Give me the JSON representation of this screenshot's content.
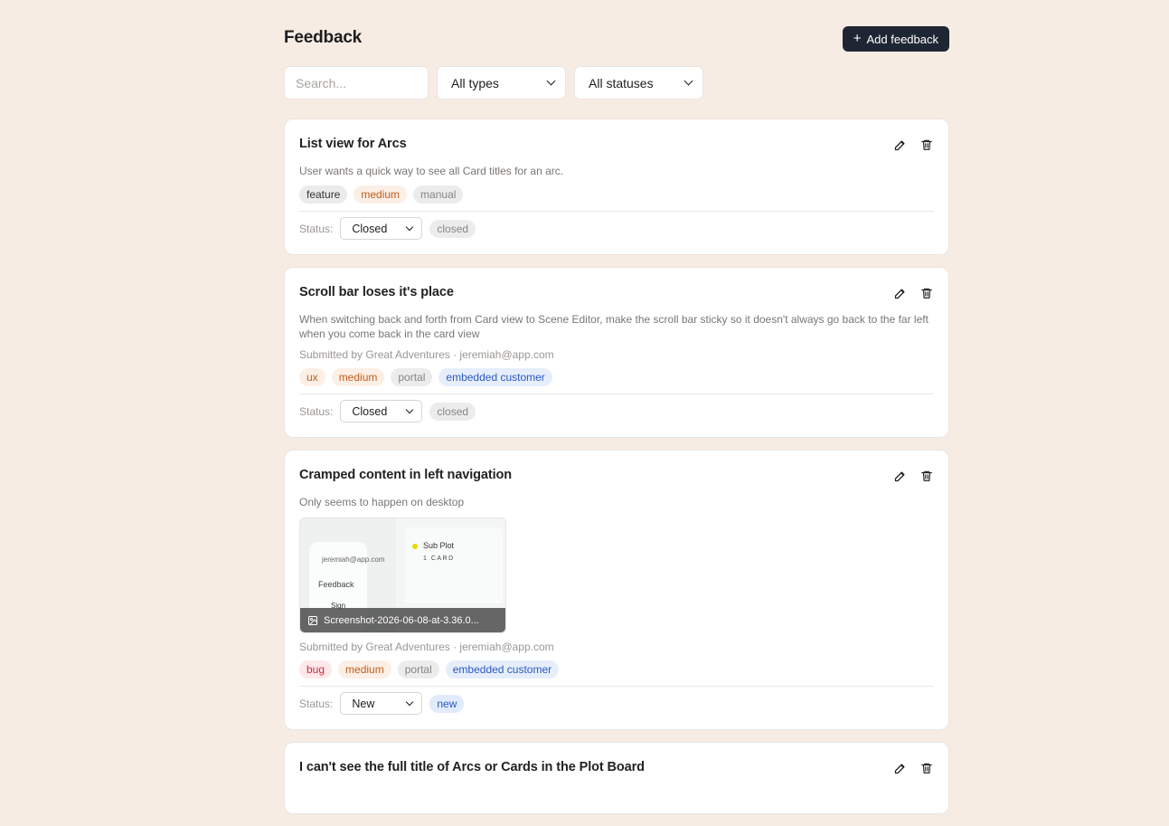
{
  "header": {
    "title": "Feedback",
    "add_button_label": "Add feedback"
  },
  "filters": {
    "search_placeholder": "Search...",
    "type_filter": "All types",
    "status_filter": "All statuses"
  },
  "status_label": "Status:",
  "cards": [
    {
      "title": "List view for Arcs",
      "description": "User wants a quick way to see all Card titles for an arc.",
      "tags": [
        "feature",
        "medium",
        "manual"
      ],
      "status": "Closed",
      "status_badge": "closed"
    },
    {
      "title": "Scroll bar loses it's place",
      "description": "When switching back and forth from Card view to Scene Editor, make the scroll bar sticky so it doesn't always go back to the far left when you come back in the card view",
      "submitted": "Submitted by Great Adventures · jeremiah@app.com",
      "tags": [
        "ux",
        "medium",
        "portal",
        "embedded customer"
      ],
      "status": "Closed",
      "status_badge": "closed"
    },
    {
      "title": "Cramped content in left navigation",
      "description": "Only seems to happen on desktop",
      "attachment": {
        "filename": "Screenshot-2026-06-08-at-3.36.0...",
        "thumb_email": "jeremiah@app.com",
        "thumb_feedback": "Feedback",
        "thumb_sign": "Sign",
        "thumb_subplot": "Sub Plot",
        "thumb_card_count": "1 CARD"
      },
      "submitted": "Submitted by Great Adventures · jeremiah@app.com",
      "tags": [
        "bug",
        "medium",
        "portal",
        "embedded customer"
      ],
      "status": "New",
      "status_badge": "new"
    },
    {
      "title": "I can't see the full title of Arcs or Cards in the Plot Board"
    }
  ],
  "colors": {
    "background": "#f7ece4",
    "primary_button": "#1f2633",
    "tag_medium_text": "#c25c1a",
    "tag_bug_text": "#c8303c",
    "tag_embedded_text": "#2a58c2"
  },
  "icons": {
    "add": "plus-icon",
    "edit": "pencil-icon",
    "delete": "trash-icon",
    "dropdown": "chevron-down-icon",
    "attachment": "image-icon"
  }
}
